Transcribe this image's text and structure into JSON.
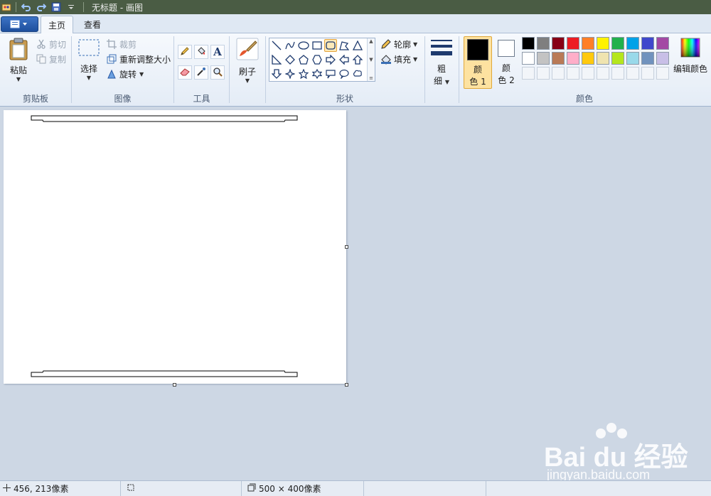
{
  "title_bar": {
    "title": "无标题 - 画图"
  },
  "tabs": {
    "home": "主页",
    "view": "查看"
  },
  "clipboard": {
    "paste": "粘贴",
    "cut": "剪切",
    "copy": "复制",
    "label": "剪贴板"
  },
  "image": {
    "select": "选择",
    "crop": "裁剪",
    "resize": "重新调整大小",
    "rotate": "旋转",
    "label": "图像"
  },
  "tools": {
    "label": "工具",
    "text_tool_glyph": "A"
  },
  "brushes": {
    "label": "刷子"
  },
  "shapes": {
    "outline": "轮廓",
    "fill": "填充",
    "label": "形状"
  },
  "size": {
    "label_line1": "粗",
    "label_line2": "细"
  },
  "colors": {
    "color1_line1": "颜",
    "color1_line2": "色 1",
    "color2_line1": "颜",
    "color2_line2": "色 2",
    "edit_colors": "编辑颜色",
    "label": "颜色",
    "color1_value": "#000000",
    "color2_value": "#ffffff",
    "palette_row1": [
      "#000000",
      "#7f7f7f",
      "#880015",
      "#ed1c24",
      "#ff7f27",
      "#fff200",
      "#22b14c",
      "#00a2e8",
      "#3f48cc",
      "#a349a4"
    ],
    "palette_row2": [
      "#ffffff",
      "#c3c3c3",
      "#b97a57",
      "#ffaec9",
      "#ffc90e",
      "#efe4b0",
      "#b5e61d",
      "#99d9ea",
      "#7092be",
      "#c8bfe7"
    ]
  },
  "status": {
    "cursor_pos": "456, 213像素",
    "canvas_size": "500 × 400像素"
  },
  "watermark": {
    "brand_line": "Bai du 经验",
    "url": "jingyan.baidu.com"
  }
}
